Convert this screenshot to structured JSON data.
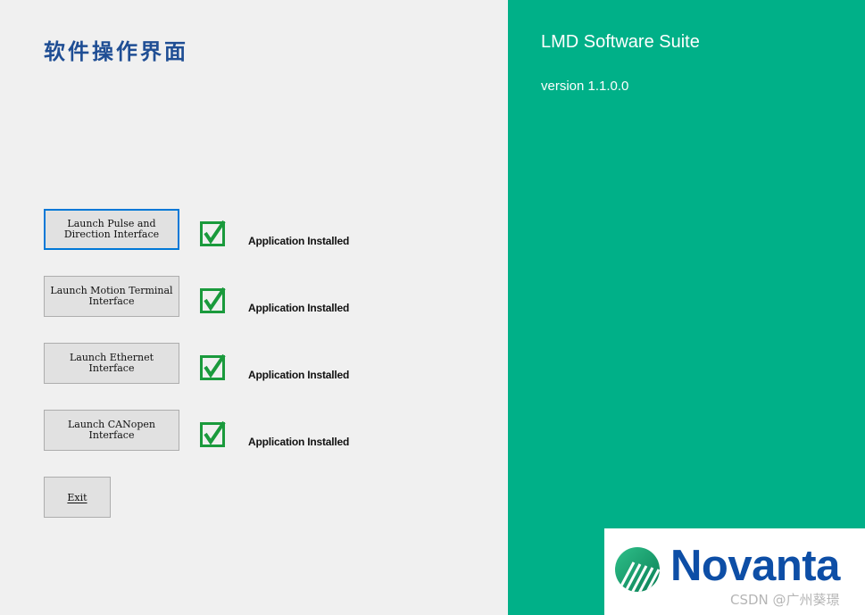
{
  "window": {
    "title": "软件操作界面"
  },
  "launchers": [
    {
      "label": "Launch Pulse and\nDirection Interface",
      "status": "Application Installed"
    },
    {
      "label": "Launch Motion Terminal\nInterface",
      "status": "Application Installed"
    },
    {
      "label": "Launch Ethernet\nInterface",
      "status": "Application Installed"
    },
    {
      "label": "Launch CANopen\nInterface",
      "status": "Application Installed"
    }
  ],
  "exit_label": "Exit",
  "suite": {
    "name": "LMD Software Suite",
    "version": "version 1.1.0.0"
  },
  "logo": {
    "text": "Novanta"
  },
  "watermark": "CSDN @广州葵璟",
  "colors": {
    "accent_panel": "#00b088",
    "title_blue": "#1f4e94",
    "check_green": "#1a9a3c",
    "logo_blue": "#0d4ea6",
    "focus_border": "#0078d7"
  },
  "icons": {
    "check": "check-square-icon",
    "logo": "novanta-logo-icon"
  }
}
